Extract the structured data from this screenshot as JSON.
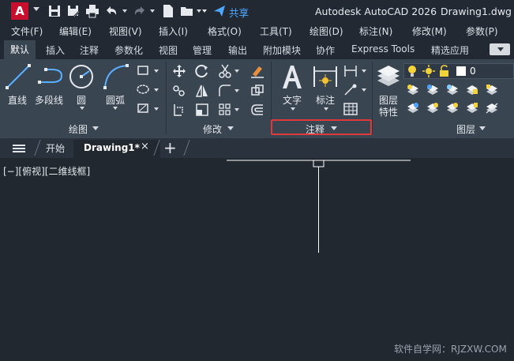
{
  "titlebar": {
    "logo_letter": "A",
    "share_label": "共享",
    "app_name": "Autodesk AutoCAD 2026",
    "document_name": "Drawing1.dwg",
    "quick_access_icons": [
      "save-icon",
      "save-as-icon",
      "print-icon",
      "undo-icon",
      "redo-icon",
      "new-icon",
      "open-icon",
      "dropdown-icon"
    ]
  },
  "menu": {
    "items": [
      "文件(F)",
      "编辑(E)",
      "视图(V)",
      "插入(I)",
      "格式(O)",
      "工具(T)",
      "绘图(D)",
      "标注(N)",
      "修改(M)",
      "参数(P)"
    ]
  },
  "ribbon": {
    "tabs": [
      "默认",
      "插入",
      "注释",
      "参数化",
      "视图",
      "管理",
      "输出",
      "附加模块",
      "协作",
      "Express Tools",
      "精选应用"
    ],
    "active_tab": "默认",
    "panels": {
      "draw": {
        "title": "绘图",
        "tools": [
          "直线",
          "多段线",
          "圆",
          "圆弧"
        ]
      },
      "modify": {
        "title": "修改"
      },
      "annotation": {
        "title": "注释",
        "tools": [
          "文字",
          "标注"
        ]
      },
      "layers": {
        "title": "图层",
        "tool": "图层\n特性",
        "tool_line1": "图层",
        "tool_line2": "特性",
        "current_layer": "0"
      }
    }
  },
  "file_tabs": {
    "start_label": "开始",
    "document_label": "Drawing1*",
    "close_glyph": "×",
    "add_glyph": "+"
  },
  "canvas": {
    "view_label": "[−][俯视][二维线框]",
    "background_color": "#212830"
  },
  "watermark": "软件自学网：RJZXW.COM",
  "colors": {
    "accent_red": "#c8102e",
    "highlight_box": "#e0393a",
    "share_blue": "#4fa8ff",
    "ribbon_bg": "#3a4552"
  }
}
